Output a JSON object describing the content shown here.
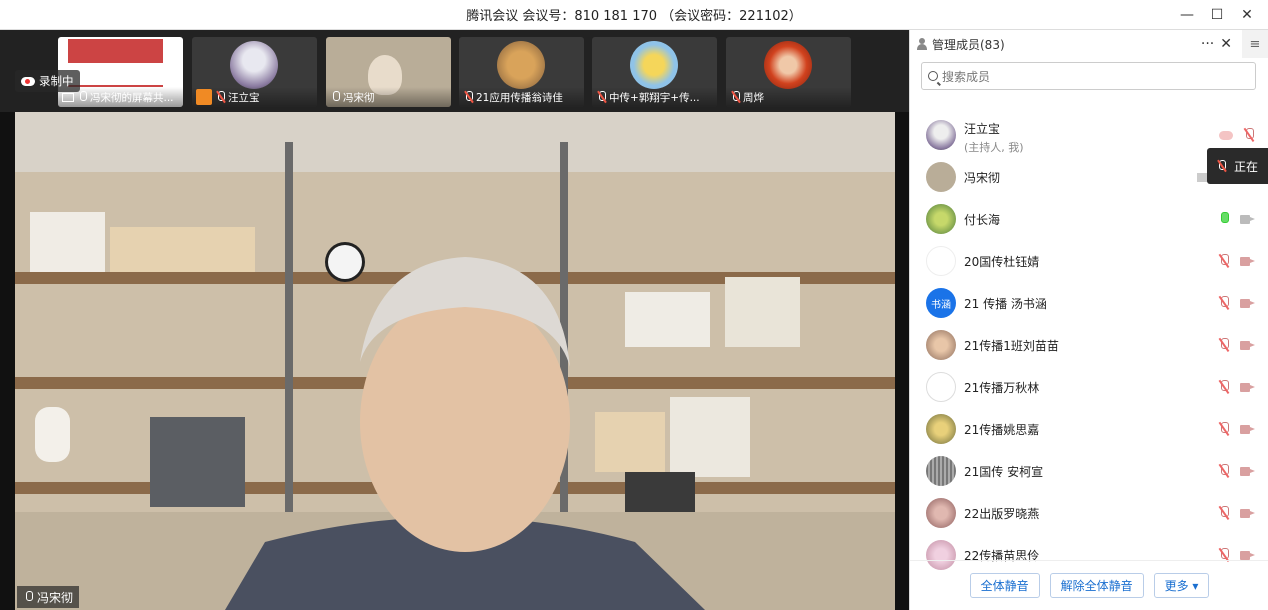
{
  "window": {
    "title": "腾讯会议 会议号：810 181 170 （会议密码：221102）",
    "minimize": "—",
    "maximize": "☐",
    "close": "✕"
  },
  "recording": {
    "label": "录制中"
  },
  "thumbnails": [
    {
      "name": "冯宋彻的屏幕共...",
      "mic": "on",
      "icon": "screen-share-icon"
    },
    {
      "name": "汪立宝",
      "mic": "muted",
      "icon": "host-icon"
    },
    {
      "name": "冯宋彻",
      "mic": "on"
    },
    {
      "name": "21应用传播翁诗佳",
      "mic": "muted"
    },
    {
      "name": "中传+郭翔宇+传...",
      "mic": "muted"
    },
    {
      "name": "周烨",
      "mic": "muted"
    }
  ],
  "main_speaker": {
    "name": "冯宋彻"
  },
  "panel": {
    "title": "管理成员(83)",
    "more": "···",
    "close": "✕",
    "menu": "≡",
    "search_placeholder": "搜索成员",
    "tooltip": "正在"
  },
  "members": [
    {
      "name": "汪立宝",
      "sub": "(主持人, 我)",
      "mic": "muted",
      "state": "recording"
    },
    {
      "name": "冯宋彻",
      "mic": "on",
      "state": "screen"
    },
    {
      "name": "付长海",
      "mic": "on",
      "cam": "on"
    },
    {
      "name": "20国传杜钰婧",
      "mic": "muted",
      "cam": "off"
    },
    {
      "name": "21 传播 汤书涵",
      "avatar_text": "书涵",
      "mic": "muted",
      "cam": "off"
    },
    {
      "name": "21传播1班刘苗苗",
      "mic": "muted",
      "cam": "off"
    },
    {
      "name": "21传播万秋林",
      "mic": "muted",
      "cam": "off"
    },
    {
      "name": "21传播姚思嘉",
      "mic": "muted",
      "cam": "off"
    },
    {
      "name": "21国传 安柯宣",
      "mic": "muted",
      "cam": "off"
    },
    {
      "name": "22出版罗晓燕",
      "mic": "muted",
      "cam": "off"
    },
    {
      "name": "22传播苗思伶",
      "mic": "muted",
      "cam": "off"
    }
  ],
  "footer": {
    "mute_all": "全体静音",
    "unmute_all": "解除全体静音",
    "more": "更多 ▾"
  }
}
